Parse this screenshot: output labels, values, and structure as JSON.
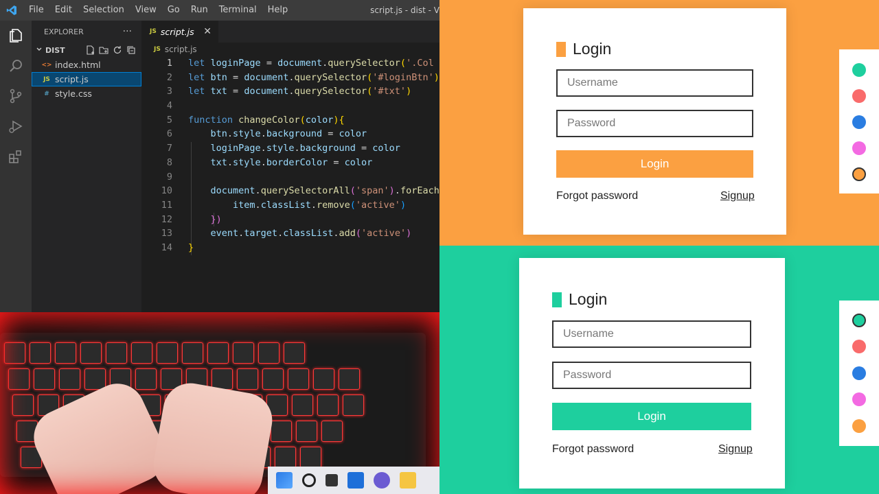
{
  "menubar": {
    "items": [
      "File",
      "Edit",
      "Selection",
      "View",
      "Go",
      "Run",
      "Terminal",
      "Help"
    ],
    "window_title": "script.js - dist - V"
  },
  "explorer": {
    "title": "EXPLORER",
    "more": "···",
    "folder": "DIST",
    "files": [
      {
        "icon": "<>",
        "name": "index.html",
        "icon_color": "#e37933"
      },
      {
        "icon": "JS",
        "name": "script.js",
        "icon_color": "#cbcb41"
      },
      {
        "icon": "#",
        "name": "style.css",
        "icon_color": "#519aba"
      }
    ]
  },
  "editor": {
    "tab_label": "script.js",
    "tab_icon": "JS",
    "tab_close": "✕",
    "breadcrumb_icon": "JS",
    "breadcrumb": "script.js",
    "line_numbers": [
      "1",
      "2",
      "3",
      "4",
      "5",
      "6",
      "7",
      "8",
      "9",
      "10",
      "11",
      "12",
      "13",
      "14"
    ],
    "active_line": "1"
  },
  "preview_orange": {
    "accent": "#fba041",
    "title": "Login",
    "username_placeholder": "Username",
    "password_placeholder": "Password",
    "button": "Login",
    "forgot": "Forgot password",
    "signup": "Signup",
    "colors": [
      "#1ecf9e",
      "#f96b6b",
      "#2a7de1",
      "#f36ae2",
      "#fba041"
    ],
    "active_color": "#fba041"
  },
  "preview_green": {
    "accent": "#1ecf9e",
    "title": "Login",
    "username_placeholder": "Username",
    "password_placeholder": "Password",
    "button": "Login",
    "forgot": "Forgot password",
    "signup": "Signup",
    "colors": [
      "#1ecf9e",
      "#f96b6b",
      "#2a7de1",
      "#f36ae2",
      "#fba041"
    ],
    "active_color": "#1ecf9e"
  }
}
